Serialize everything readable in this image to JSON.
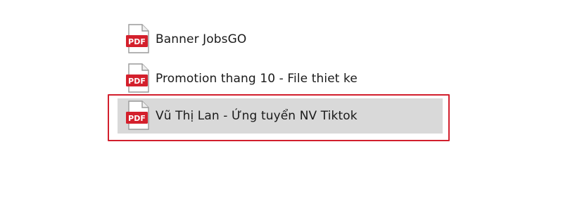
{
  "files": [
    {
      "name": "Banner JobsGO",
      "type_badge": "PDF",
      "selected": false
    },
    {
      "name": "Promotion thang 10 - File thiet ke",
      "type_badge": "PDF",
      "selected": false
    },
    {
      "name": "Vũ Thị Lan - Ứng tuyển NV Tiktok",
      "type_badge": "PDF",
      "selected": true
    }
  ],
  "colors": {
    "selection_outline": "#d21f2d",
    "selected_row_bg": "#d9d9d9",
    "pdf_badge": "#d4202c"
  },
  "icons": {
    "file": "pdf-file-icon"
  }
}
